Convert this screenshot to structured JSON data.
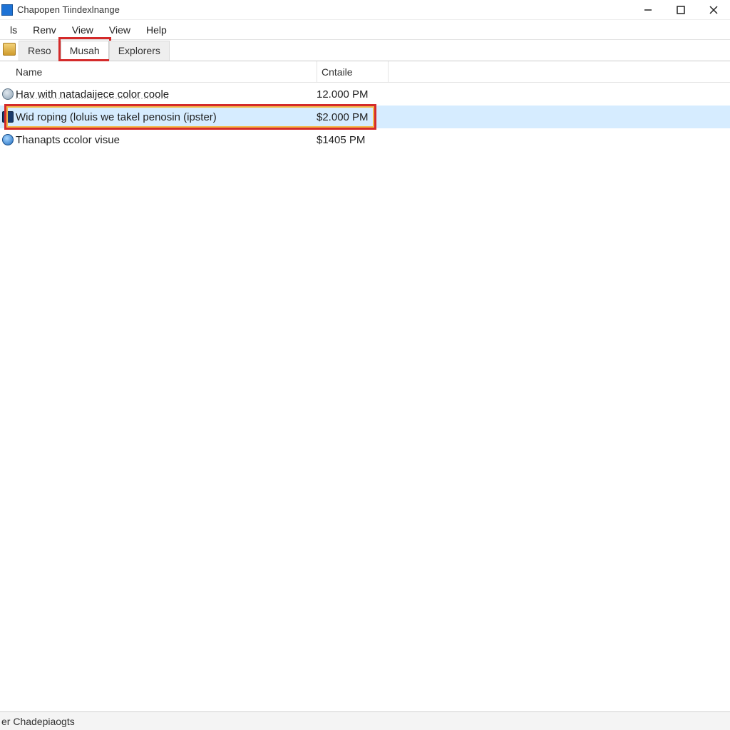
{
  "titlebar": {
    "title": "Chapopen Tiindexlnange"
  },
  "menu": {
    "items": [
      "ls",
      "Renv",
      "View",
      "View",
      "Help"
    ]
  },
  "tabs": {
    "items": [
      {
        "label": "Reso",
        "active": false
      },
      {
        "label": "Musah",
        "active": true
      },
      {
        "label": "Explorers",
        "active": false
      }
    ]
  },
  "columns": {
    "name": "Name",
    "cntaile": "Cntaile"
  },
  "rows": [
    {
      "icon": "gear",
      "name": "Hav with natadaijece color coole",
      "cntaile": "12.000 PM",
      "selected": false
    },
    {
      "icon": "bluesq",
      "name": "Wid roping (loluis we takel penosin (ipster)",
      "cntaile": "$2.000 PM",
      "selected": true
    },
    {
      "icon": "globe",
      "name": "Thanapts ccolor visue",
      "cntaile": "$1405 PM",
      "selected": false
    }
  ],
  "statusbar": {
    "text": "er Chadepiaogts"
  },
  "highlight_row_index": 1
}
